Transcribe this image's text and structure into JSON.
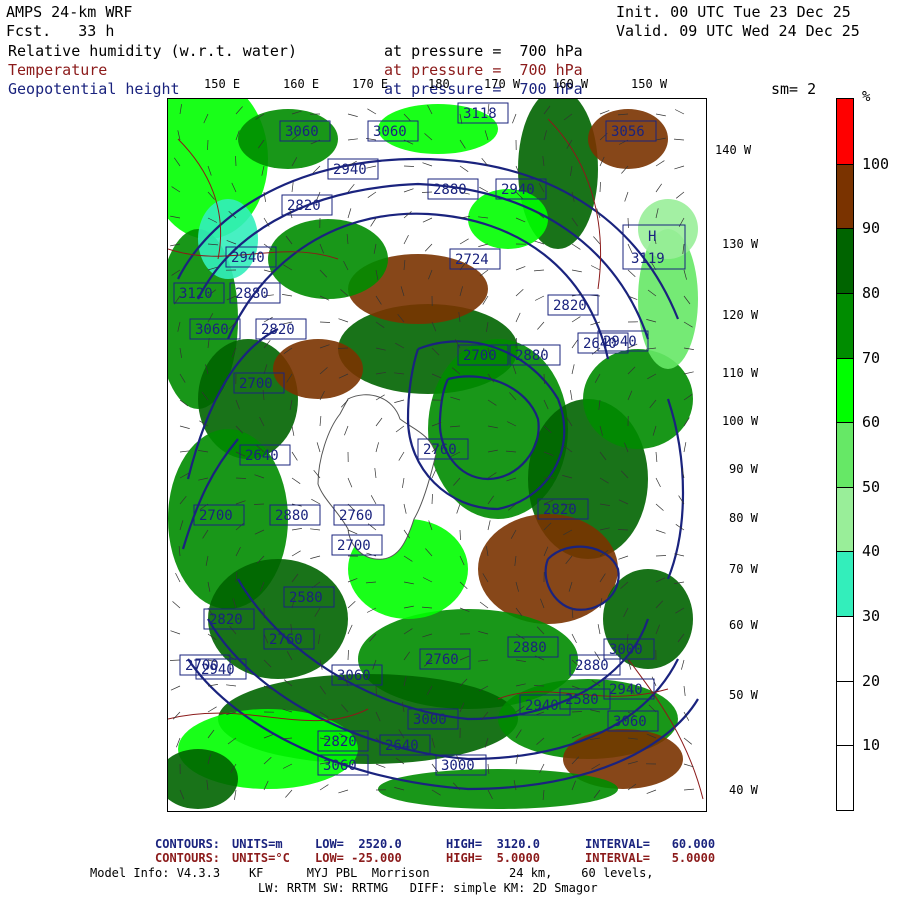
{
  "header": {
    "model": "AMPS 24-km WRF",
    "fcst": "Fcst.   33 h",
    "init": "Init. 00 UTC Tue 23 Dec 25",
    "valid": "Valid. 09 UTC Wed 24 Dec 25"
  },
  "fields": [
    {
      "name": "Relative humidity (w.r.t. water)",
      "level": "at pressure =  700 hPa",
      "color": "#000000"
    },
    {
      "name": "Temperature",
      "level": "at pressure =  700 hPa",
      "color": "#8b1a1a"
    },
    {
      "name": "Geopotential height",
      "level": "at pressure =  700 hPa",
      "color": "#1a237e"
    }
  ],
  "smoothing": "sm= 2",
  "lon_top": [
    "150 E",
    "160 E",
    "170 E",
    "180",
    "170 W",
    "160 W",
    "150 W"
  ],
  "lon_right": [
    "140 W",
    "130 W",
    "120 W",
    "110 W",
    "100 W",
    "90 W",
    "80 W",
    "70 W",
    "60 W",
    "50 W",
    "40 W"
  ],
  "colorbar": {
    "unit": "%",
    "labels": [
      "100",
      "90",
      "80",
      "70",
      "60",
      "50",
      "40",
      "30",
      "20",
      "10"
    ],
    "bins": [
      {
        "value": 100,
        "color": "#ff0000"
      },
      {
        "value": 90,
        "color": "#7a3300"
      },
      {
        "value": 80,
        "color": "#006400"
      },
      {
        "value": 70,
        "color": "#008c00"
      },
      {
        "value": 60,
        "color": "#00ff00"
      },
      {
        "value": 50,
        "color": "#66e866"
      },
      {
        "value": 40,
        "color": "#99ee99"
      },
      {
        "value": 30,
        "color": "#33eebb"
      },
      {
        "value": 20,
        "color": "#ffffff"
      },
      {
        "value": 10,
        "color": "#ffffff"
      },
      {
        "value": 0,
        "color": "#ffffff"
      }
    ]
  },
  "height_labels": [
    "3060",
    "3060",
    "3118",
    "3056",
    "2940",
    "2880",
    "2940",
    "2820",
    "3119",
    "2940",
    "2724",
    "3120",
    "2880",
    "2820",
    "3060",
    "2820",
    "2940",
    "2700",
    "2880",
    "2640",
    "2760",
    "2700",
    "2640",
    "2880",
    "2700",
    "2760",
    "2700",
    "2820",
    "2580",
    "2880",
    "2760",
    "2820",
    "2700",
    "3000",
    "2940",
    "3060",
    "2760",
    "2940",
    "3060",
    "3000",
    "2820",
    "2640",
    "3060",
    "3000",
    "2580",
    "2880",
    "2940"
  ],
  "high_marker": "H",
  "footer": {
    "line1": {
      "label": "CONTOURS:",
      "units": "UNITS=m",
      "low": "LOW=  2520.0",
      "high": "HIGH=  3120.0",
      "interval": "INTERVAL=   60.000"
    },
    "line2": {
      "label": "CONTOURS:",
      "units": "UNITS=°C",
      "low": "LOW= -25.000",
      "high": "HIGH=  5.0000",
      "interval": "INTERVAL=   5.0000"
    },
    "line3": "Model Info: V4.3.3    KF      MYJ PBL  Morrison           24 km,    60 levels,",
    "line4": "LW: RRTM SW: RRTMG   DIFF: simple KM: 2D Smagor"
  }
}
